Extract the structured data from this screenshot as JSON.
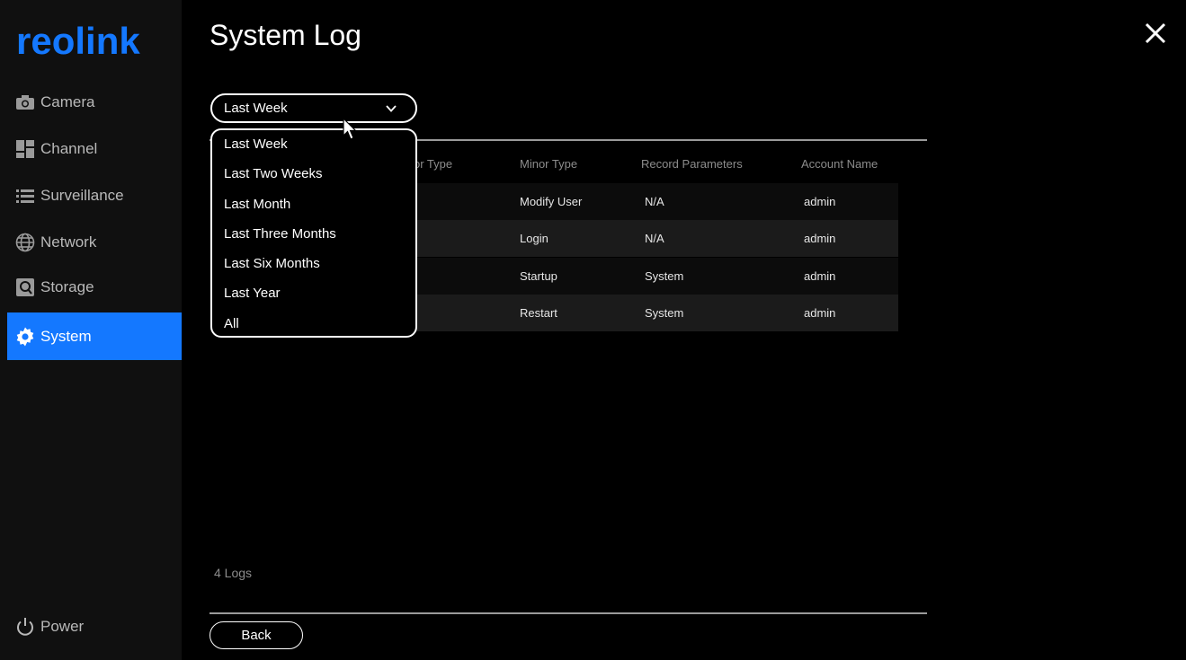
{
  "brand": {
    "logo_text": "reolink",
    "accent": "#1478ff"
  },
  "sidebar": {
    "items": [
      {
        "label": "Camera",
        "icon": "camera-icon"
      },
      {
        "label": "Channel",
        "icon": "channel-grid-icon"
      },
      {
        "label": "Surveillance",
        "icon": "list-icon"
      },
      {
        "label": "Network",
        "icon": "globe-icon"
      },
      {
        "label": "Storage",
        "icon": "storage-icon"
      },
      {
        "label": "System",
        "icon": "gear-icon",
        "active": true
      }
    ],
    "power_label": "Power"
  },
  "header": {
    "title": "System Log"
  },
  "filter": {
    "selected": "Last Week",
    "options": [
      "Last Week",
      "Last Two Weeks",
      "Last Month",
      "Last Three Months",
      "Last Six Months",
      "Last Year",
      "All"
    ]
  },
  "table": {
    "columns": [
      "or Type",
      "Minor Type",
      "Record Parameters",
      "Account Name"
    ],
    "rows": [
      {
        "minor_type": "Modify User",
        "params": "N/A",
        "account": "admin"
      },
      {
        "minor_type": "Login",
        "params": "N/A",
        "account": "admin"
      },
      {
        "minor_type": "Startup",
        "params": "System",
        "account": "admin"
      },
      {
        "minor_type": "Restart",
        "params": "System",
        "account": "admin"
      }
    ]
  },
  "footer": {
    "logs_count": "4 Logs",
    "back_label": "Back"
  }
}
